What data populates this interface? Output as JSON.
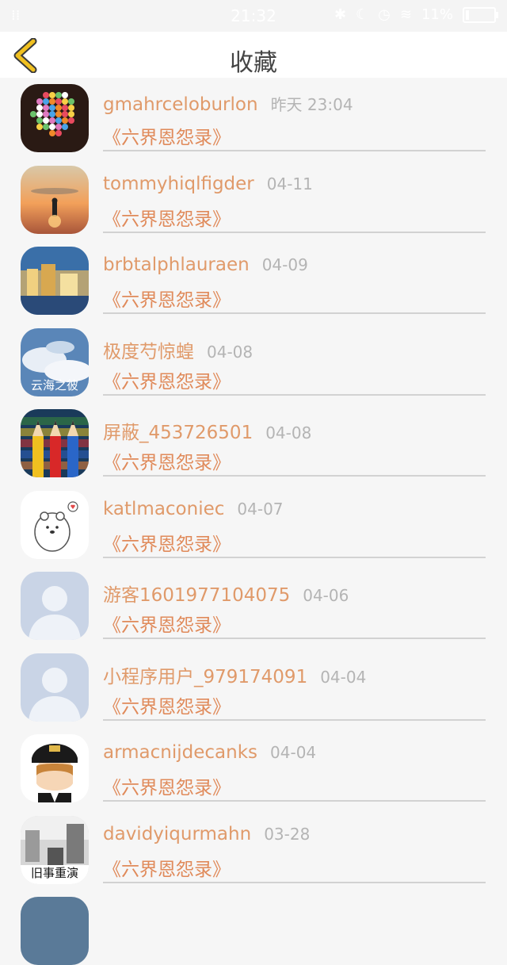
{
  "status_bar": {
    "time": "21:32",
    "battery": "11%"
  },
  "nav": {
    "title": "收藏",
    "back_icon": "chevron-left-icon",
    "accent": "#f0c020"
  },
  "favorites": [
    {
      "user": "gmahrceloburlon",
      "time": "昨天 23:04",
      "book": "《六界恩怨录》",
      "avatar": "heart-flowers"
    },
    {
      "user": "tommyhiqlfigder",
      "time": "04-11",
      "book": "《六界恩怨录》",
      "avatar": "sunset-figure"
    },
    {
      "user": "brbtalphlauraen",
      "time": "04-09",
      "book": "《六界恩怨录》",
      "avatar": "rainy-city"
    },
    {
      "user": "极度芍惊蝗",
      "time": "04-08",
      "book": "《六界恩怨录》",
      "avatar": "sky-clouds",
      "avatar_text": "云海之彼"
    },
    {
      "user": "屏蔽_453726501",
      "time": "04-08",
      "book": "《六界恩怨录》",
      "avatar": "color-pencils"
    },
    {
      "user": "katlmaconiec",
      "time": "04-07",
      "book": "《六界恩怨录》",
      "avatar": "cartoon-bear"
    },
    {
      "user": "游客1601977104075",
      "time": "04-06",
      "book": "《六界恩怨录》",
      "avatar": "default-person"
    },
    {
      "user": "小程序用户_979174091",
      "time": "04-04",
      "book": "《六界恩怨录》",
      "avatar": "default-person"
    },
    {
      "user": "armacnijdecanks",
      "time": "04-04",
      "book": "《六界恩怨录》",
      "avatar": "anime-captain"
    },
    {
      "user": "davidyiqurmahn",
      "time": "03-28",
      "book": "《六界恩怨录》",
      "avatar": "street-bw",
      "avatar_text": "旧事重演"
    }
  ]
}
